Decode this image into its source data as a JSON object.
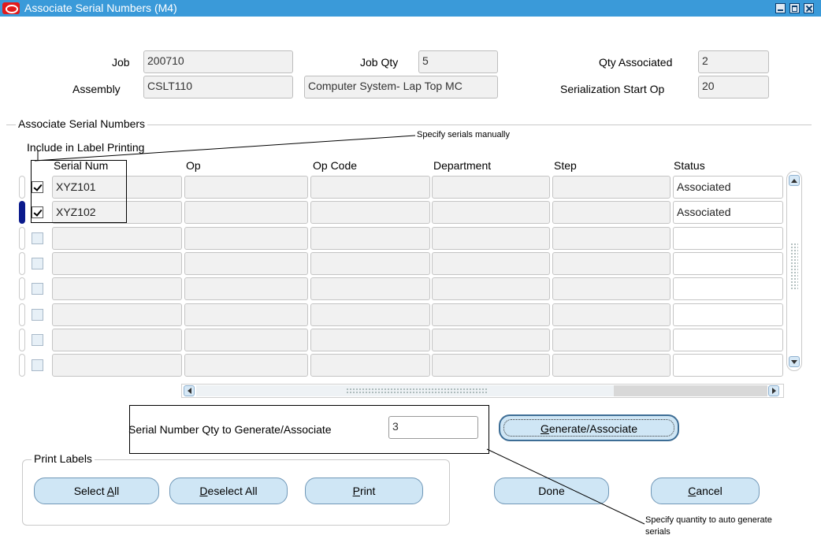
{
  "window": {
    "title": "Associate Serial Numbers (M4)"
  },
  "header": {
    "job_label": "Job",
    "job_value": "200710",
    "job_qty_label": "Job Qty",
    "job_qty_value": "5",
    "qty_associated_label": "Qty Associated",
    "qty_associated_value": "2",
    "assembly_label": "Assembly",
    "assembly_value": "CSLT110",
    "assembly_desc_value": "Computer System- Lap Top MC",
    "serialization_start_op_label": "Serialization Start Op",
    "serialization_start_op_value": "20"
  },
  "grid": {
    "section_title": "Associate Serial Numbers",
    "include_label": "Include in Label Printing",
    "columns": [
      "Serial Num",
      "Op",
      "Op Code",
      "Department",
      "Step",
      "Status"
    ],
    "rows": [
      {
        "checked": true,
        "serial": "XYZ101",
        "op": "",
        "op_code": "",
        "department": "",
        "step": "",
        "status": "Associated",
        "current": false
      },
      {
        "checked": true,
        "serial": "XYZ102",
        "op": "",
        "op_code": "",
        "department": "",
        "step": "",
        "status": "Associated",
        "current": true
      },
      {
        "checked": false,
        "serial": "",
        "op": "",
        "op_code": "",
        "department": "",
        "step": "",
        "status": "",
        "current": false
      },
      {
        "checked": false,
        "serial": "",
        "op": "",
        "op_code": "",
        "department": "",
        "step": "",
        "status": "",
        "current": false
      },
      {
        "checked": false,
        "serial": "",
        "op": "",
        "op_code": "",
        "department": "",
        "step": "",
        "status": "",
        "current": false
      },
      {
        "checked": false,
        "serial": "",
        "op": "",
        "op_code": "",
        "department": "",
        "step": "",
        "status": "",
        "current": false
      },
      {
        "checked": false,
        "serial": "",
        "op": "",
        "op_code": "",
        "department": "",
        "step": "",
        "status": "",
        "current": false
      },
      {
        "checked": false,
        "serial": "",
        "op": "",
        "op_code": "",
        "department": "",
        "step": "",
        "status": "",
        "current": false
      }
    ]
  },
  "generate": {
    "qty_label": "Serial Number Qty to Generate/Associate",
    "qty_value": "3",
    "button_mnemonic": "G",
    "button_rest": "enerate/Associate"
  },
  "print_labels": {
    "title": "Print Labels",
    "select_all_pre": "Select ",
    "select_all_mn": "A",
    "select_all_post": "ll",
    "deselect_all_mn": "D",
    "deselect_all_post": "eselect All",
    "print_mn": "P",
    "print_post": "rint"
  },
  "actions": {
    "done_label": "Done",
    "cancel_mn": "C",
    "cancel_post": "ancel"
  },
  "annotations": {
    "manual_note": "Specify serials manually",
    "auto_note": "Specify quantity to auto generate serials"
  },
  "colors": {
    "titlebar": "#3a9ad9",
    "button_fill": "#cfe6f5",
    "current_row_indicator": "#0a1a8c"
  }
}
